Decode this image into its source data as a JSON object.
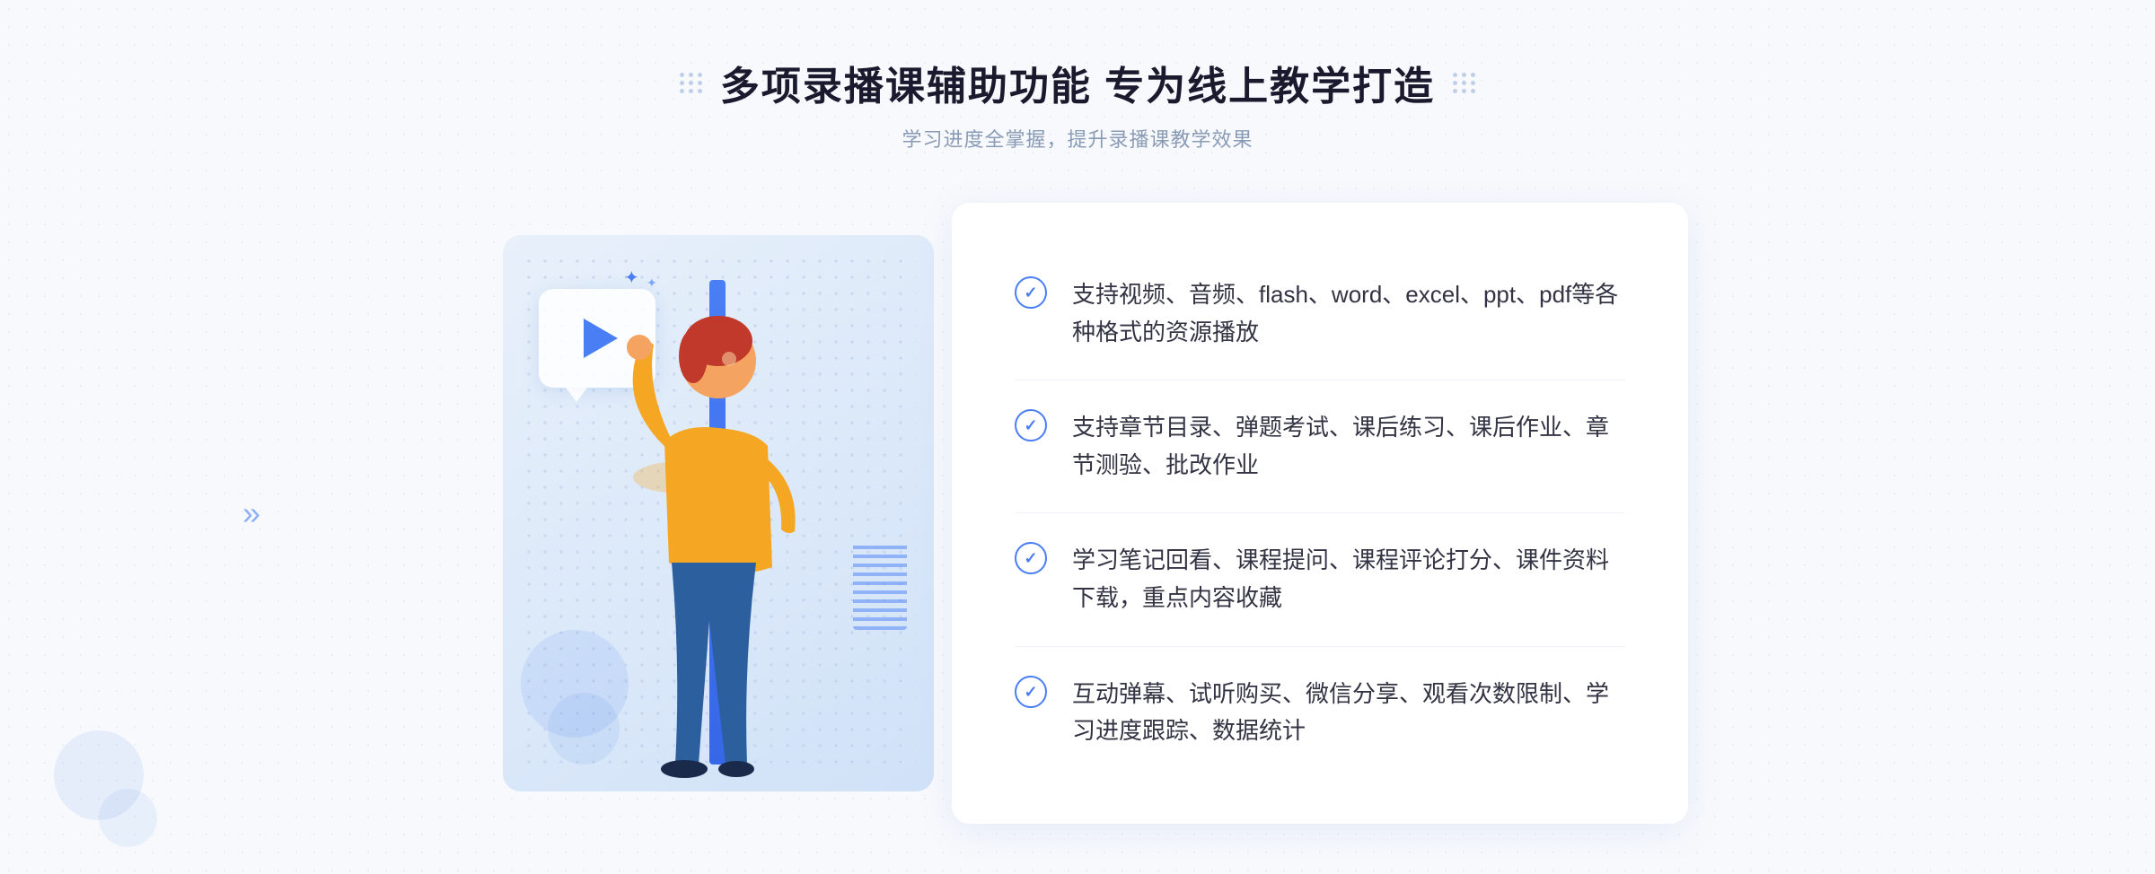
{
  "header": {
    "main_title": "多项录播课辅助功能 专为线上教学打造",
    "subtitle": "学习进度全掌握，提升录播课教学效果",
    "left_dots_label": "decorative-dots-left",
    "right_dots_label": "decorative-dots-right"
  },
  "features": [
    {
      "id": 1,
      "text": "支持视频、音频、flash、word、excel、ppt、pdf等各种格式的资源播放"
    },
    {
      "id": 2,
      "text": "支持章节目录、弹题考试、课后练习、课后作业、章节测验、批改作业"
    },
    {
      "id": 3,
      "text": "学习笔记回看、课程提问、课程评论打分、课件资料下载，重点内容收藏"
    },
    {
      "id": 4,
      "text": "互动弹幕、试听购买、微信分享、观看次数限制、学习进度跟踪、数据统计"
    }
  ],
  "illustration": {
    "play_button_label": "play-button",
    "chevrons_left": "«"
  },
  "colors": {
    "primary_blue": "#4a7ef5",
    "text_dark": "#333344",
    "text_gray": "#8a9bb5",
    "bg_light": "#f7f9fc"
  }
}
